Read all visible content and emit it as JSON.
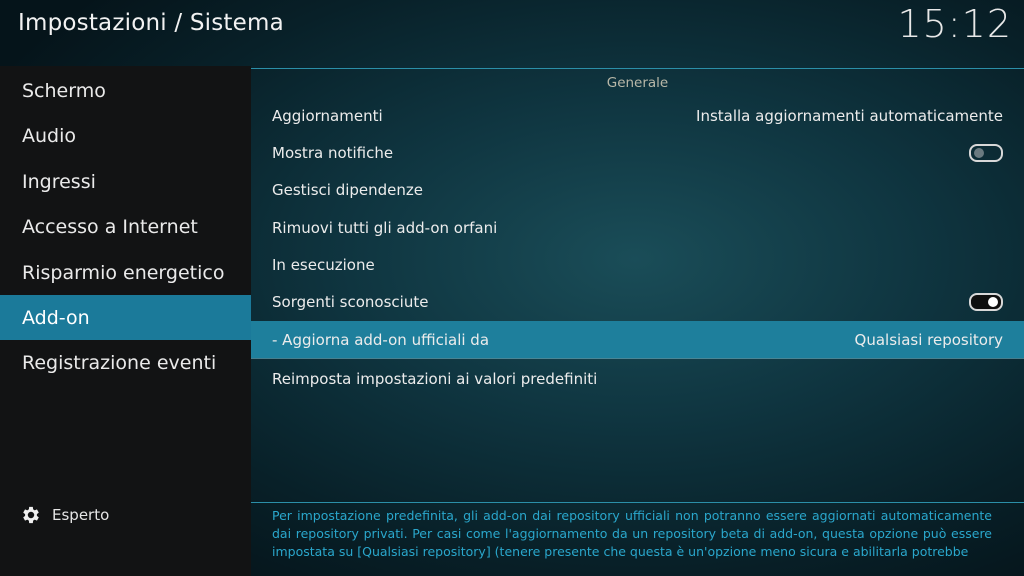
{
  "header": {
    "title": "Impostazioni / Sistema",
    "clock": "15:12"
  },
  "sidebar": {
    "items": [
      {
        "label": "Schermo"
      },
      {
        "label": "Audio"
      },
      {
        "label": "Ingressi"
      },
      {
        "label": "Accesso a Internet"
      },
      {
        "label": "Risparmio energetico"
      },
      {
        "label": "Add-on",
        "active": true
      },
      {
        "label": "Registrazione eventi"
      }
    ],
    "level_label": "Esperto",
    "level_icon": "gear-icon"
  },
  "main": {
    "section_title": "Generale",
    "settings": [
      {
        "label": "Aggiornamenti",
        "value": "Installa aggiornamenti automaticamente"
      },
      {
        "label": "Mostra notifiche",
        "toggle": false
      },
      {
        "label": "Gestisci dipendenze"
      },
      {
        "label": "Rimuovi tutti gli add-on orfani"
      },
      {
        "label": "In esecuzione"
      },
      {
        "label": "Sorgenti sconosciute",
        "toggle": true
      },
      {
        "label": "- Aggiorna add-on ufficiali da",
        "value": "Qualsiasi repository",
        "focused": true
      },
      {
        "label": "Reimposta impostazioni ai valori predefiniti"
      }
    ],
    "description": "Per impostazione predefinita, gli add-on dai repository ufficiali non potranno essere aggiornati automaticamente dai repository privati. Per casi come l'aggiornamento da un repository beta di add-on, questa opzione può essere impostata su [Qualsiasi repository] (tenere presente che questa è un'opzione meno sicura e abilitarla potrebbe"
  },
  "colors": {
    "accent": "#1e7f9c",
    "sidebar_bg": "#121314",
    "description_text": "#2aa7cc"
  }
}
